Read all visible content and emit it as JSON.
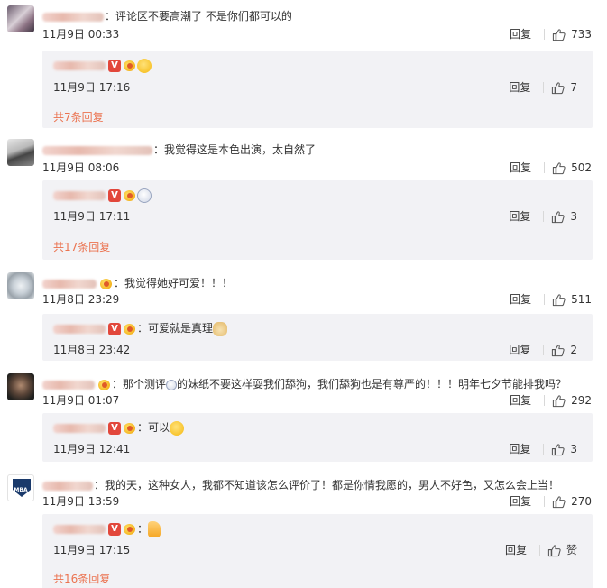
{
  "labels": {
    "reply": "回复",
    "like_zero": "赞"
  },
  "colors": {
    "link": "#eb7350",
    "reply_bg": "#f2f2f5",
    "text": "#333333"
  },
  "comments": [
    {
      "text": "：评论区不要高潮了 不是你们都可以的",
      "time": "11月9日 00:33",
      "likes": "733",
      "reply": {
        "text": "",
        "emoji": "laughing-crying-emoji",
        "time": "11月9日 17:16",
        "likes": "7"
      },
      "more": "共7条回复"
    },
    {
      "text": "：我觉得这是本色出演，太自然了",
      "time": "11月9日 08:06",
      "likes": "502",
      "reply": {
        "text": "",
        "emoji": "panda-emoji",
        "time": "11月9日 17:11",
        "likes": "3"
      },
      "more": "共17条回复"
    },
    {
      "text": "：我觉得她好可爱！！！",
      "time": "11月8日 23:29",
      "likes": "511",
      "reply": {
        "text": "：可爱就是真理",
        "emoji": "doge-emoji",
        "time": "11月8日 23:42",
        "likes": "2"
      }
    },
    {
      "text": "：那个测评",
      "text_b": "的妹纸不要这样耍我们舔狗，我们舔狗也是有尊严的！！！明年七夕节能排我吗？",
      "time": "11月9日 01:07",
      "likes": "292",
      "reply": {
        "text": "：可以",
        "emoji": "laughing-crying-emoji",
        "time": "11月9日 12:41",
        "likes": "3"
      }
    },
    {
      "text": "：我的天，这种女人，我都不知道该怎么评价了！都是你情我愿的，男人不好色，又怎么会上当！",
      "time": "11月9日 13:59",
      "likes": "270",
      "reply": {
        "text": "：",
        "emoji": "thumbs-up-emoji",
        "time": "11月9日 17:15",
        "likes": "赞"
      },
      "more": "共16条回复"
    }
  ]
}
